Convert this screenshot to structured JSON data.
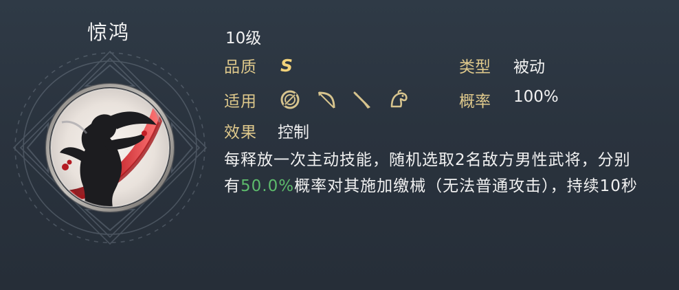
{
  "skill": {
    "name": "惊鸿",
    "level": "10级"
  },
  "labels": {
    "quality": "品质",
    "type": "类型",
    "applicable": "适用",
    "chance": "概率",
    "effect": "效果"
  },
  "values": {
    "quality": "S",
    "type": "被动",
    "chance": "100%",
    "effect": "控制"
  },
  "description": {
    "part1": "每释放一次主动技能，随机选取2名敌方男性武将，分别有",
    "highlight": "50.0%",
    "part2": "概率对其施加缴械（无法普通攻击），持续10秒"
  },
  "icons": {
    "applicable": [
      "shield-icon",
      "bow-icon",
      "spear-icon",
      "horse-icon"
    ],
    "emblem": "skill-emblem-portrait"
  },
  "colors": {
    "label_gold": "#dec88b",
    "quality_gold": "#f2d27a",
    "highlight_green": "#5dbb6c",
    "text_white": "#f1f1f1",
    "background": "#2b343f"
  }
}
